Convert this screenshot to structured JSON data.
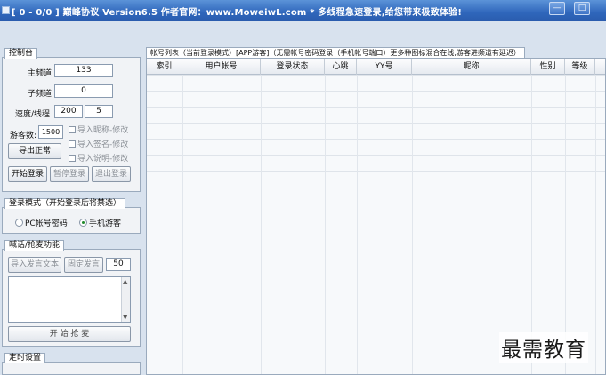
{
  "window": {
    "title": "[ 0 - 0/0 ]   巅峰协议 Version6.5    作者官网：www.MoweiwL.com  *    多线程急速登录,给您带来极致体验!",
    "minimize_glyph": "—",
    "maximize_glyph": "□"
  },
  "control_panel": {
    "title": "控制台",
    "main_channel_label": "主频道",
    "main_channel_value": "133",
    "sub_channel_label": "子频道",
    "sub_channel_value": "0",
    "speed_label": "速度/线程",
    "speed_value": "200",
    "thread_value": "5",
    "guest_count_label": "游客数:",
    "guest_count_value": "1500",
    "import_nickname": "导入昵称-修改",
    "import_signature": "导入签名-修改",
    "import_description": "导入说明-修改",
    "export_button": "导出正常",
    "start_login": "开始登录",
    "pause_login": "暂停登录",
    "exit_login": "退出登录"
  },
  "login_mode": {
    "title": "登录模式（开始登录后将禁选）",
    "pc_account": "PC帐号密码",
    "mobile_guest": "手机游客",
    "selected": "mobile_guest"
  },
  "shout": {
    "title": "喊话/抢麦功能",
    "import_text": "导入发言文本",
    "fixed_speech": "固定发言",
    "interval_value": "50",
    "start_grab": "开 始 抢 麦"
  },
  "timer": {
    "title": "定时设置"
  },
  "account_list": {
    "tab_label": "帐号列表（当前登录模式）[APP游客]（无需帐号密码登录（手机帐号端口）更多种图标混合在线,游客进频道有延迟）",
    "columns": [
      "索引",
      "用户帐号",
      "登录状态",
      "心跳",
      "YY号",
      "昵称",
      "性别",
      "等级"
    ]
  },
  "watermark": "最需教育"
}
